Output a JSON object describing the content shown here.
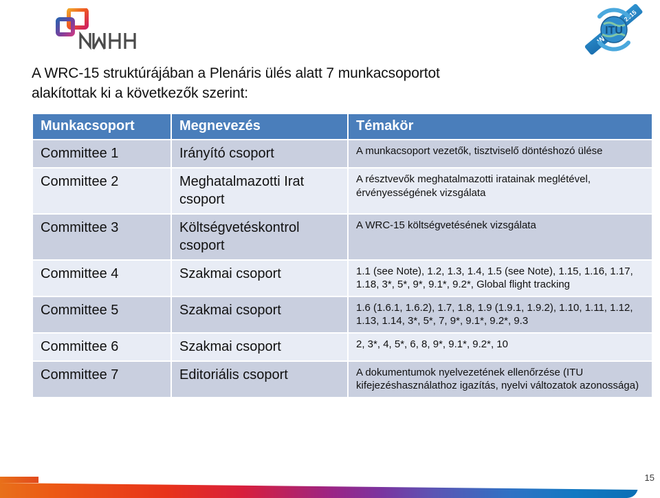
{
  "slide": {
    "page_number": "15",
    "title_line1": "A WRC-15 struktúrájában a Plenáris ülés alatt 7 munkacsoportot",
    "title_line2": "alakítottak ki a következők szerint:"
  },
  "logos": {
    "nmhh": {
      "name": "nmhh-logo",
      "wordmark": "NMHH"
    },
    "itu": {
      "name": "itu-wrc15-logo",
      "center_text": "ITU",
      "band_text": "WRC-15",
      "year_text": "2015"
    }
  },
  "table": {
    "headers": [
      "Munkacsoport",
      "Megnevezés",
      "Témakör"
    ],
    "header_bg": "#4a7ebb",
    "band_a": "#c9cfdf",
    "band_b": "#e8ecf5",
    "rows": [
      {
        "group": "Committee 1",
        "name": "Irányító csoport",
        "topic": "A munkacsoport vezetők, tisztviselő döntéshozó ülése"
      },
      {
        "group": "Committee 2",
        "name": "Meghatalmazotti Irat csoport",
        "topic": "A résztvevők meghatalmazotti iratainak meglétével, érvényességének vizsgálata"
      },
      {
        "group": "Committee 3",
        "name": "Költségvetéskontrol csoport",
        "topic": "A WRC-15 költségvetésének vizsgálata"
      },
      {
        "group": "Committee 4",
        "name": "Szakmai csoport",
        "topic": "1.1 (see Note), 1.2, 1.3, 1.4, 1.5 (see Note), 1.15, 1.16, 1.17, 1.18, 3*, 5*, 9*, 9.1*, 9.2*, Global flight tracking"
      },
      {
        "group": "Committee 5",
        "name": "Szakmai csoport",
        "topic": "1.6 (1.6.1, 1.6.2), 1.7, 1.8, 1.9 (1.9.1, 1.9.2), 1.10, 1.11, 1.12, 1.13, 1.14, 3*, 5*, 7, 9*, 9.1*, 9.2*, 9.3"
      },
      {
        "group": "Committee 6",
        "name": "Szakmai csoport",
        "topic": "2, 3*, 4, 5*, 6, 8, 9*, 9.1*, 9.2*, 10"
      },
      {
        "group": "Committee 7",
        "name": "Editoriális csoport",
        "topic": "A dokumentumok nyelvezetének ellenőrzése (ITU kifejezéshasználathoz igazítás, nyelvi változatok azonossága)"
      }
    ]
  }
}
